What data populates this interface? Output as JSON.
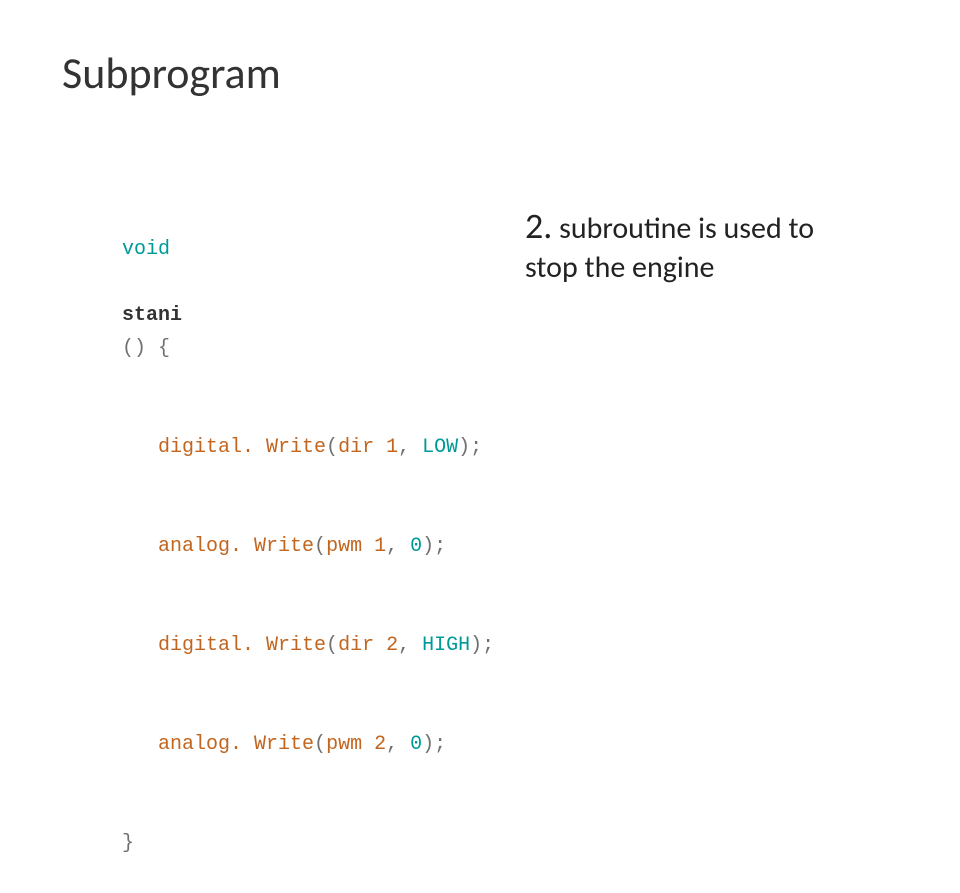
{
  "title": "Subprogram",
  "code": {
    "kw_void": "void",
    "fn_name": "stani",
    "open": "() {",
    "lines": [
      {
        "call": "digital. Write",
        "arg": "dir 1",
        "val": "LOW"
      },
      {
        "call": "analog. Write",
        "arg": "pwm 1",
        "val": "0"
      },
      {
        "call": "digital. Write",
        "arg": "dir 2",
        "val": "HIGH"
      },
      {
        "call": "analog. Write",
        "arg": "pwm 2",
        "val": "0"
      }
    ],
    "close": "}"
  },
  "caption": {
    "num": "2.",
    "text_a": " subroutine is used to",
    "text_b": "stop the engine"
  }
}
